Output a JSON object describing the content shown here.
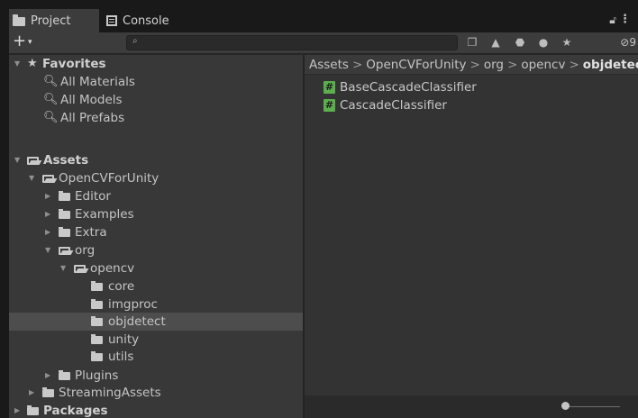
{
  "tabs": {
    "project": "Project",
    "console": "Console"
  },
  "toolbar": {
    "add": "+",
    "add_caret": "▾",
    "search_placeholder": "",
    "hidden_packages_count": "9"
  },
  "favorites": {
    "title": "Favorites",
    "items": [
      "All Materials",
      "All Models",
      "All Prefabs"
    ]
  },
  "tree": {
    "assets": "Assets",
    "opencvforunity": "OpenCVForUnity",
    "editor": "Editor",
    "examples": "Examples",
    "extra": "Extra",
    "org": "org",
    "opencv": "opencv",
    "core": "core",
    "imgproc": "imgproc",
    "objdetect": "objdetect",
    "unity": "unity",
    "utils": "utils",
    "plugins": "Plugins",
    "streamingassets": "StreamingAssets",
    "packages": "Packages"
  },
  "breadcrumb": {
    "items": [
      "Assets",
      "OpenCVForUnity",
      "org",
      "opencv"
    ],
    "current": "objdetect",
    "separator": ">"
  },
  "files": [
    "BaseCascadeClassifier",
    "CascadeClassifier"
  ],
  "colors": {
    "script_icon": "#5cae4e",
    "selection": "#4d4d4d"
  }
}
